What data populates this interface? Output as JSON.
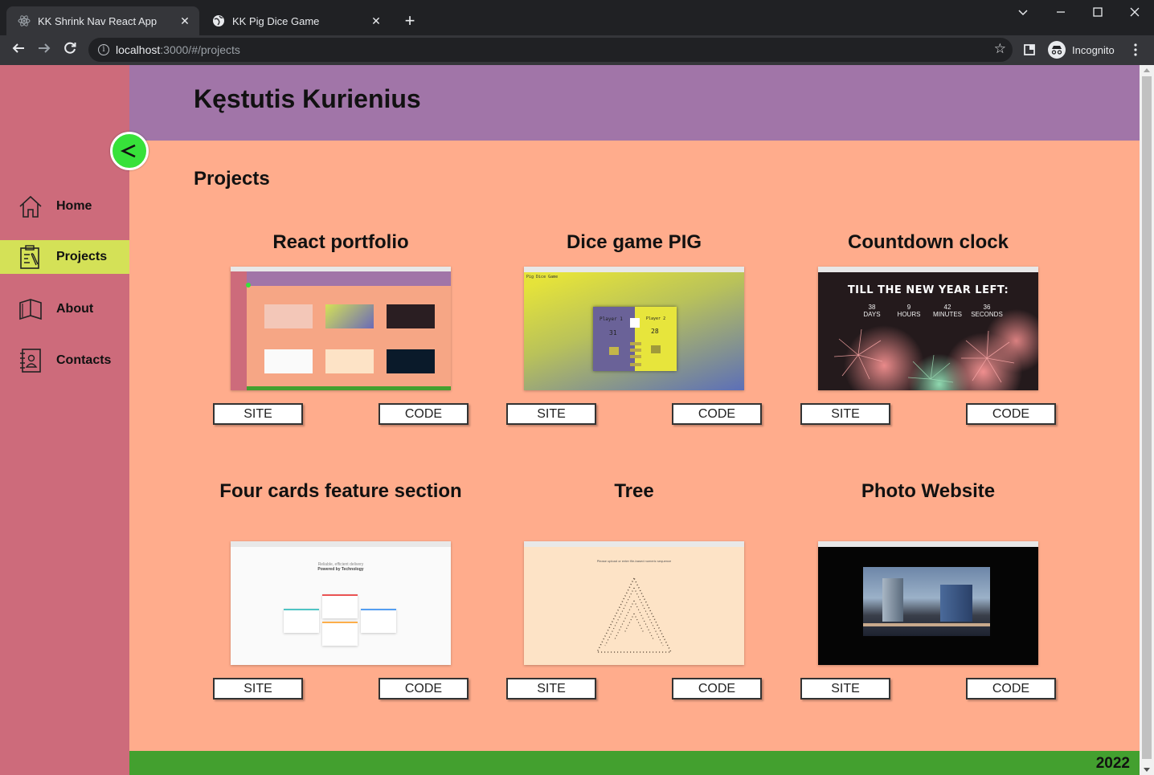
{
  "browser": {
    "tabs": [
      {
        "title": "KK Shrink Nav React App",
        "close": "✕"
      },
      {
        "title": "KK Pig Dice Game",
        "close": "✕"
      }
    ],
    "new_tab": "+",
    "url_host": "localhost",
    "url_path": ":3000/#/projects",
    "incognito_label": "Incognito"
  },
  "sidebar": {
    "toggle_symbol": "<",
    "items": [
      {
        "label": "Home",
        "icon": "home-icon"
      },
      {
        "label": "Projects",
        "icon": "projects-icon",
        "active": true
      },
      {
        "label": "About",
        "icon": "book-icon"
      },
      {
        "label": "Contacts",
        "icon": "contacts-icon"
      }
    ]
  },
  "header": {
    "title": "Kęstutis Kurienius"
  },
  "main": {
    "section_title": "Projects",
    "projects": [
      {
        "title": "React portfolio",
        "site_label": "SITE",
        "code_label": "CODE"
      },
      {
        "title": "Dice game PIG",
        "site_label": "SITE",
        "code_label": "CODE"
      },
      {
        "title": "Countdown clock",
        "site_label": "SITE",
        "code_label": "CODE"
      },
      {
        "title": "Four cards feature section",
        "site_label": "SITE",
        "code_label": "CODE"
      },
      {
        "title": "Tree",
        "site_label": "SITE",
        "code_label": "CODE"
      },
      {
        "title": "Photo Website",
        "site_label": "SITE",
        "code_label": "CODE"
      }
    ],
    "countdown_preview": {
      "heading": "TILL THE NEW YEAR LEFT:",
      "units": [
        {
          "value": "38",
          "label": "DAYS"
        },
        {
          "value": "9",
          "label": "HOURS"
        },
        {
          "value": "42",
          "label": "MINUTES"
        },
        {
          "value": "36",
          "label": "SECONDS"
        }
      ]
    },
    "dice_preview": {
      "game_title": "Pig Dice Game",
      "player1": "Player 1",
      "score1": "31",
      "player2": "Player 2",
      "score2": "28"
    },
    "four_cards_preview": {
      "line1": "Reliable, efficient delivery",
      "line2": "Powered by Technology"
    },
    "tree_preview": {
      "line1": "Please upload or enter file-based numeric sequence"
    }
  },
  "footer": {
    "year": "2022"
  },
  "colors": {
    "sidebar": "#cd6b7b",
    "header": "#a175a8",
    "page": "#ffac8c",
    "active_nav": "#d4e157",
    "toggle": "#37e13a",
    "footer": "#43a02f"
  }
}
